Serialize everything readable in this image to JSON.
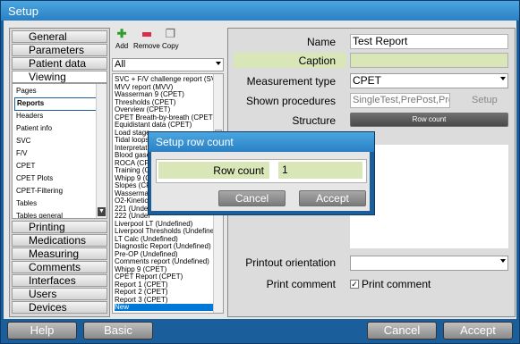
{
  "window": {
    "title": "Setup"
  },
  "nav": {
    "top": [
      "General",
      "Parameters",
      "Patient data",
      "Viewing"
    ],
    "sub": [
      "Pages",
      "Reports",
      "Headers",
      "Patient info",
      "SVC",
      "F/V",
      "CPET",
      "CPET Plots",
      "CPET-Filtering",
      "Tables",
      "Tables general"
    ],
    "bottom": [
      "Printing",
      "Medications",
      "Measuring",
      "Comments",
      "Interfaces",
      "Users",
      "Devices"
    ]
  },
  "toolbar": {
    "add": "Add",
    "remove": "Remove",
    "copy": "Copy"
  },
  "filter": {
    "value": "All"
  },
  "reports": [
    "SVC + F/V challenge report (SVC",
    "MVV report (MVV)",
    "Wasserman 9 (CPET)",
    "Thresholds (CPET)",
    "Overview (CPET)",
    "CPET Breath-by-breath (CPET)",
    "Equidistant data (CPET)",
    "Load stage",
    "Tidal loops",
    "Interpretati",
    "Blood gase",
    "ROCA (CP",
    "Training (C",
    "Whipp 9 (C",
    "Slopes (CP",
    "Wasserma",
    "O2-Kinetic",
    "221 (Undef",
    "222 (Undef",
    "Liverpool LT (Undefined)",
    "Liverpool Thresholds (Undefined)",
    "LT Calc (Undefined)",
    "Diagnostic Report (Undefined)",
    "Pre-OP (Undefined)",
    "Comments report (Undefined)",
    "Whipp 9 (CPET)",
    "CPET Report  (CPET)",
    "Report 1 (CPET)",
    "Report 2 (CPET)",
    "Report 3 (CPET)",
    "New"
  ],
  "form": {
    "name_label": "Name",
    "name_value": "Test Report",
    "caption_label": "Caption",
    "caption_value": "",
    "mtype_label": "Measurement type",
    "mtype_value": "CPET",
    "procedures_label": "Shown procedures",
    "procedures_value": "SingleTest,PrePost,Prov",
    "setup_label": "Setup",
    "structure_label": "Structure",
    "structure_button": "Row count",
    "orientation_label": "Printout orientation",
    "orientation_value": "",
    "print_comment_label": "Print comment",
    "print_comment_check": "Print comment"
  },
  "dialog": {
    "title": "Setup row count",
    "row_count_label": "Row count",
    "row_count_value": "1",
    "cancel": "Cancel",
    "accept": "Accept"
  },
  "footer": {
    "help": "Help",
    "basic": "Basic",
    "cancel": "Cancel",
    "accept": "Accept"
  },
  "colors": {
    "frame": "#1a5f9c",
    "accent_green": "#d8e6b8",
    "selection": "#0078d7"
  }
}
